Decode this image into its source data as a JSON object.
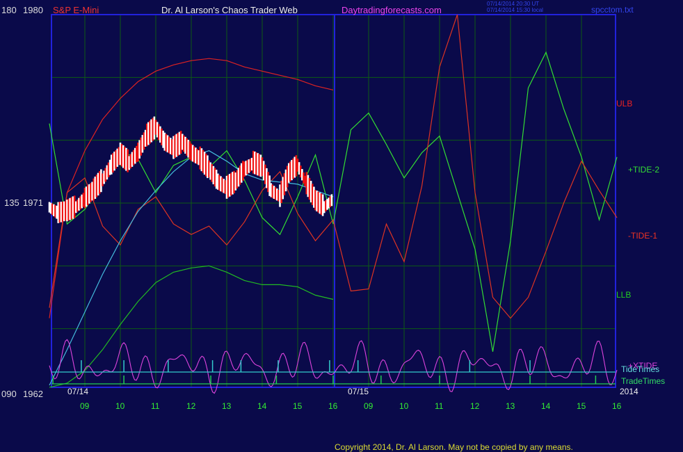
{
  "header": {
    "instrument": "S&P E-Mini",
    "site_title": "Dr. Al Larson's Chaos Trader Web",
    "site_url": "Daytradingforecasts.com",
    "stamp_ut": "07/14/2014 20:30 UT",
    "stamp_local": "07/14/2014 15:30 local",
    "file": "spcctom.txt"
  },
  "colors": {
    "background": "#0a0a4a",
    "frame": "#2222dd",
    "grid": "#0d5a14",
    "ulb": "#dd2222",
    "llb": "#22bb22",
    "tide2": "#33dd33",
    "tide1": "#dd3322",
    "xtide": "#dd44dd",
    "tidetimes": "#33cccc",
    "tradetimes": "#22cc55",
    "avg": "#44bbdd"
  },
  "footer": {
    "copyright": "Copyright 2014, Dr. Al Larson. May not be copied by any means."
  },
  "chart_data": {
    "type": "line",
    "title": "S&P E-Mini",
    "y_axis_labels": [
      {
        "angle": "180",
        "price": "1980"
      },
      {
        "angle": "135",
        "price": "1971"
      },
      {
        "angle": "090",
        "price": "1962"
      }
    ],
    "ylim": [
      1962,
      1980
    ],
    "day_labels": [
      "07/14",
      "07/15",
      "2014"
    ],
    "x_ticks": [
      "09",
      "10",
      "11",
      "12",
      "13",
      "14",
      "15",
      "16",
      "09",
      "10",
      "11",
      "12",
      "13",
      "14",
      "15",
      "16"
    ],
    "legend": [
      "ULB",
      "+TIDE-2",
      "-TIDE-1",
      "LLB",
      "+XTIDE",
      "TideTimes",
      "TradeTimes"
    ],
    "series": [
      {
        "name": "ULB",
        "x": [
          8.0,
          8.5,
          9.0,
          9.5,
          10.0,
          10.5,
          11.0,
          11.5,
          12.0,
          12.5,
          13.0,
          13.5,
          14.0,
          14.5,
          15.0,
          15.5,
          16.0
        ],
        "y": [
          1965.5,
          1971.5,
          1973.5,
          1975.0,
          1976.0,
          1976.8,
          1977.3,
          1977.6,
          1977.8,
          1977.9,
          1977.8,
          1977.5,
          1977.3,
          1977.1,
          1976.9,
          1976.6,
          1976.4
        ]
      },
      {
        "name": "LLB",
        "x": [
          8.0,
          8.5,
          9.0,
          9.5,
          10.0,
          10.5,
          11.0,
          11.5,
          12.0,
          12.5,
          13.0,
          13.5,
          14.0,
          14.5,
          15.0,
          15.5,
          16.0
        ],
        "y": [
          1962.2,
          1962.4,
          1963.0,
          1964.0,
          1965.2,
          1966.3,
          1967.2,
          1967.7,
          1967.9,
          1968.0,
          1967.7,
          1967.3,
          1967.1,
          1967.1,
          1967.0,
          1966.6,
          1966.4
        ]
      },
      {
        "name": "+TIDE-2",
        "x": [
          8.0,
          8.5,
          9.0,
          9.5,
          10.0,
          10.5,
          11.0,
          11.5,
          12.0,
          12.5,
          13.0,
          13.5,
          14.0,
          14.5,
          15.0,
          15.5,
          16.0,
          16.5,
          17.0,
          17.5,
          18.0,
          18.5,
          19.0,
          19.5,
          20.0,
          20.5,
          21.0,
          21.5,
          22.0,
          22.5,
          23.0,
          23.5,
          24.0
        ],
        "y": [
          1974.8,
          1970.0,
          1970.7,
          1972.0,
          1973.5,
          1973.1,
          1971.5,
          1972.8,
          1973.2,
          1972.7,
          1973.5,
          1972.1,
          1970.3,
          1969.5,
          1971.3,
          1973.3,
          1970.0,
          1974.5,
          1975.3,
          1973.8,
          1972.2,
          1973.4,
          1974.2,
          1971.5,
          1968.8,
          1963.9,
          1969.2,
          1976.5,
          1978.2,
          1975.5,
          1973.2,
          1970.2,
          1973.2
        ]
      },
      {
        "name": "-TIDE-1",
        "x": [
          8.0,
          8.5,
          9.0,
          9.5,
          10.0,
          10.5,
          11.0,
          11.5,
          12.0,
          12.5,
          13.0,
          13.5,
          14.0,
          14.5,
          15.0,
          15.5,
          16.0,
          16.5,
          17.0,
          17.5,
          18.0,
          18.5,
          19.0,
          19.5,
          20.0,
          20.5,
          21.0,
          21.5,
          22.0,
          22.5,
          23.0,
          23.5,
          24.0
        ],
        "y": [
          1966.0,
          1971.5,
          1972.2,
          1969.9,
          1969.0,
          1970.7,
          1971.3,
          1970.0,
          1969.5,
          1969.9,
          1969.0,
          1970.1,
          1971.6,
          1972.5,
          1970.5,
          1969.2,
          1970.2,
          1966.8,
          1966.9,
          1970.0,
          1968.2,
          1971.8,
          1977.5,
          1980.0,
          1971.5,
          1966.5,
          1965.5,
          1966.5,
          1968.7,
          1971.0,
          1973.0,
          1971.6,
          1970.3
        ]
      },
      {
        "name": "Price",
        "x": [
          8.0,
          8.25,
          8.5,
          8.75,
          9.0,
          9.25,
          9.5,
          9.75,
          10.0,
          10.25,
          10.5,
          10.75,
          11.0,
          11.25,
          11.5,
          11.75,
          12.0,
          12.25,
          12.5,
          12.75,
          13.0,
          13.25,
          13.5,
          13.75,
          14.0,
          14.25,
          14.5,
          14.75,
          15.0,
          15.25,
          15.5,
          15.75,
          16.0
        ],
        "y": [
          1970.8,
          1970.5,
          1970.6,
          1970.8,
          1971.2,
          1971.6,
          1972.1,
          1972.8,
          1973.3,
          1972.9,
          1973.4,
          1974.2,
          1974.6,
          1973.9,
          1973.6,
          1973.9,
          1973.4,
          1973.1,
          1972.6,
          1972.0,
          1971.7,
          1972.0,
          1972.6,
          1972.9,
          1972.7,
          1971.6,
          1971.3,
          1972.4,
          1972.8,
          1971.9,
          1971.1,
          1970.8,
          1971.2
        ]
      },
      {
        "name": "Average",
        "x": [
          8.0,
          8.5,
          9.0,
          9.5,
          10.0,
          10.5,
          11.0,
          11.5,
          12.0,
          12.5,
          13.0,
          13.5,
          14.0,
          14.5,
          15.0,
          15.5,
          16.0
        ],
        "y": [
          1962.3,
          1964.0,
          1965.8,
          1967.6,
          1969.2,
          1970.6,
          1971.6,
          1972.5,
          1973.2,
          1973.5,
          1973.0,
          1972.4,
          1972.1,
          1972.0,
          1971.9,
          1971.6,
          1971.3
        ]
      }
    ],
    "xtide": {
      "name": "+XTIDE"
    },
    "tide_times": [
      8.9,
      10.1,
      11.35,
      12.6,
      13.4,
      14.45,
      15.9,
      16.7,
      19.85,
      21.55
    ],
    "trade_times": [
      8.1,
      10.1,
      12.55,
      14.4,
      16.0,
      17.35,
      19.0,
      21.55,
      23.4
    ],
    "grid": true
  }
}
